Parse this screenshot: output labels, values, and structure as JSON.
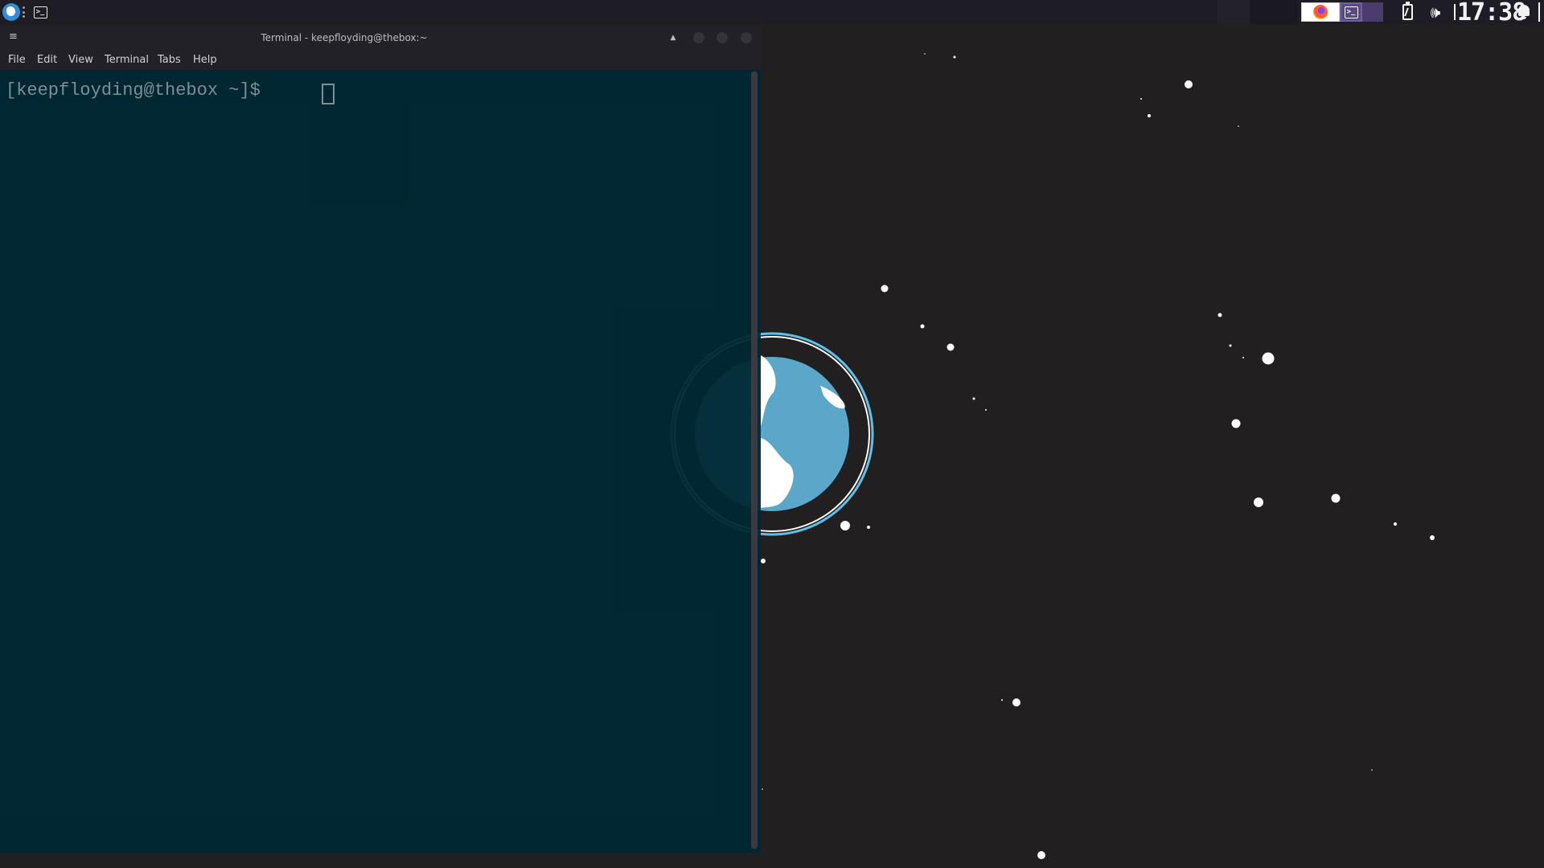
{
  "panel": {
    "clock": "17:38",
    "taskbar": [
      {
        "app": "Firefox",
        "icon": "firefox-icon"
      },
      {
        "app": "Terminal",
        "icon": "terminal-icon",
        "active": true
      }
    ]
  },
  "terminal": {
    "title": "Terminal - keepfloyding@thebox:~",
    "menus": [
      "File",
      "Edit",
      "View",
      "Terminal",
      "Tabs",
      "Help"
    ],
    "prompt": "[keepfloyding@thebox ~]$ "
  },
  "colors": {
    "terminal_bg": "#002834",
    "desktop_bg": "#221f20",
    "planet": "#5aa7c9",
    "panel_bg": "#1e1d25"
  }
}
